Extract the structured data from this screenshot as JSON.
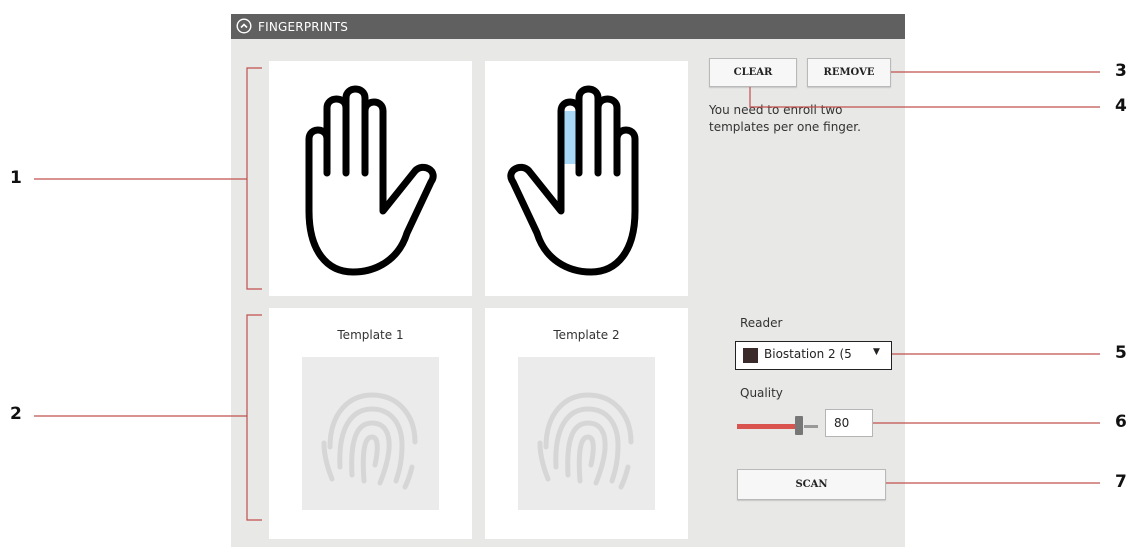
{
  "header": {
    "title": "FINGERPRINTS",
    "toggle_icon": "chevron-up-circle-icon"
  },
  "hands": {
    "left_icon": "left-hand-icon",
    "right_icon": "right-hand-icon",
    "highlight_color": "#a8d8f5"
  },
  "templates": [
    {
      "label": "Template 1",
      "icon": "fingerprint-icon"
    },
    {
      "label": "Template 2",
      "icon": "fingerprint-icon"
    }
  ],
  "actions": {
    "clear_label": "CLEAR",
    "remove_label": "REMOVE",
    "scan_label": "SCAN"
  },
  "enroll_note": "You need to enroll two templates per one finger.",
  "reader": {
    "label": "Reader",
    "selected": "Biostation 2 (5",
    "icon": "device-icon"
  },
  "quality": {
    "label": "Quality",
    "value": "80"
  },
  "callouts": [
    "1",
    "2",
    "3",
    "4",
    "5",
    "6",
    "7"
  ],
  "colors": {
    "callout_line": "#c0504d",
    "header_bg": "#606060",
    "panel_bg": "#e8e8e6",
    "slider_fill": "#d9534f"
  }
}
